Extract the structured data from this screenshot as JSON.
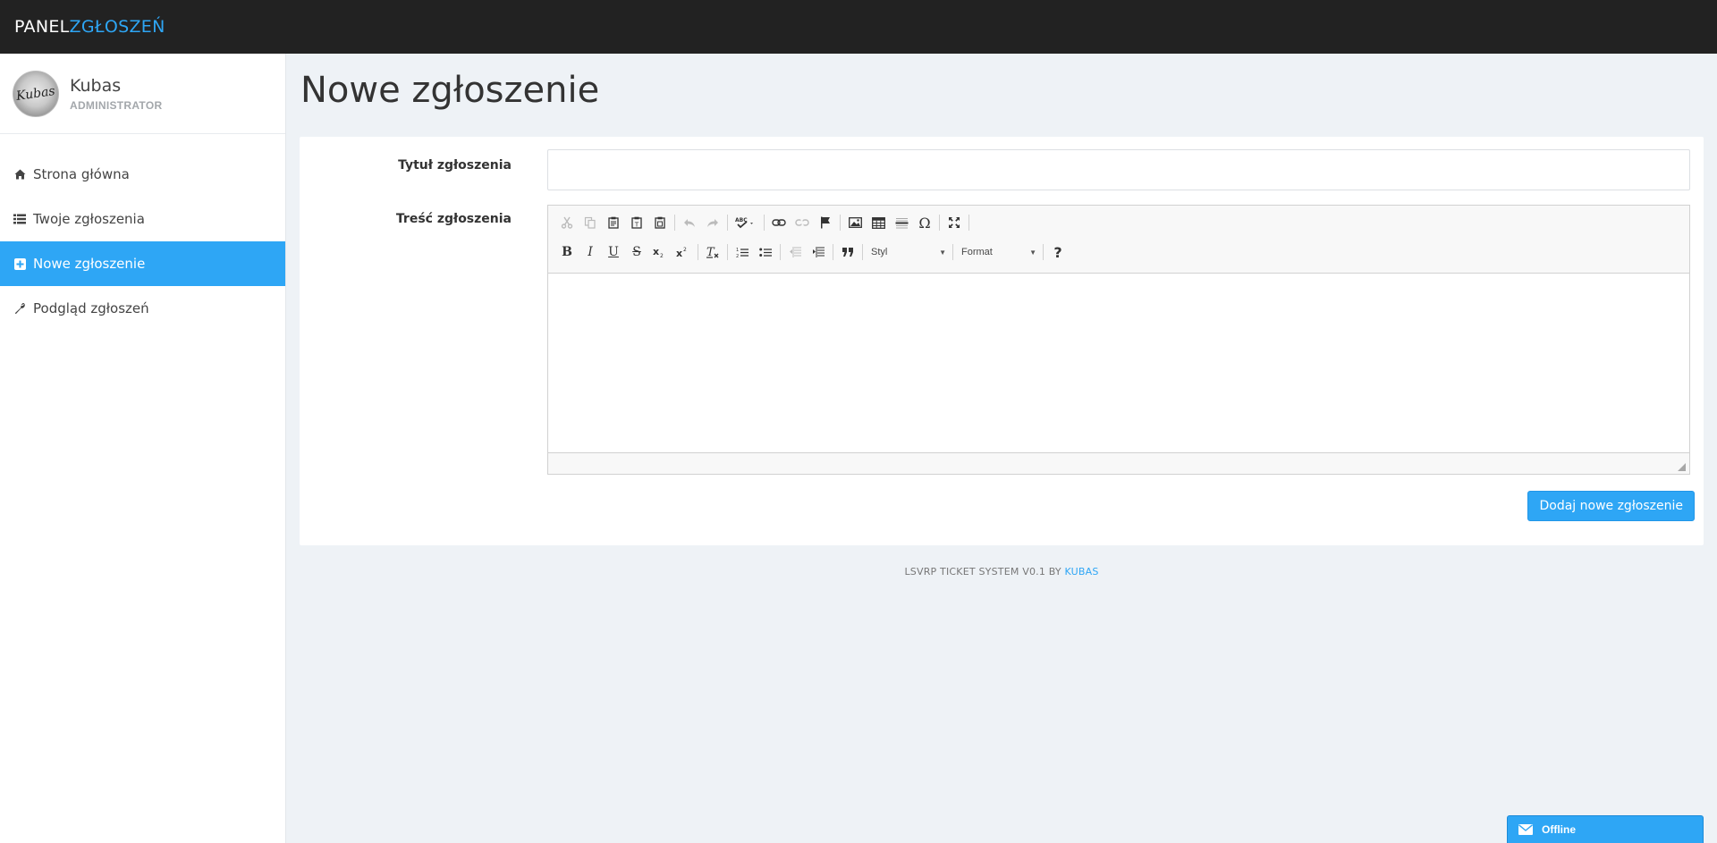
{
  "brand": {
    "part1": "PANEL",
    "part2": "ZGŁOSZEŃ"
  },
  "user": {
    "name": "Kubas",
    "role": "ADMINISTRATOR",
    "avatar_text": "Kubas"
  },
  "nav": [
    {
      "label": "Strona główna",
      "icon": "home-icon"
    },
    {
      "label": "Twoje zgłoszenia",
      "icon": "list-icon"
    },
    {
      "label": "Nowe zgłoszenie",
      "icon": "plus-square-icon",
      "active": true
    },
    {
      "label": "Podgląd zgłoszeń",
      "icon": "wrench-icon"
    }
  ],
  "page": {
    "title": "Nowe zgłoszenie"
  },
  "form": {
    "title_label": "Tytuł zgłoszenia",
    "title_value": "",
    "content_label": "Treść zgłoszenia",
    "style_combo": "Styl",
    "format_combo": "Format",
    "submit_label": "Dodaj nowe zgłoszenie"
  },
  "footer": {
    "text": "LSVRP TICKET SYSTEM V0.1 BY ",
    "link": "KUBAS"
  },
  "chat": {
    "status": "Offline"
  },
  "colors": {
    "accent": "#2ea6f5",
    "topbar": "#222222",
    "background": "#eef2f6"
  }
}
